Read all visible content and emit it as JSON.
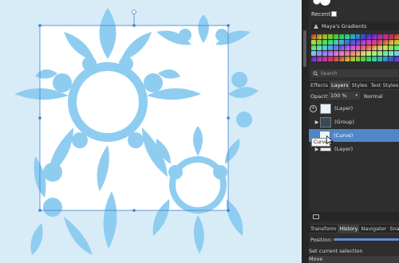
{
  "panel": {
    "recent_label": "Recent:",
    "gradients_name": "Maya's Gradients",
    "search_placeholder": "Search",
    "tabs_top": [
      "Effects",
      "Layers",
      "Styles",
      "Text Styles"
    ],
    "active_top_tab": "Layers",
    "opacity_label": "Opacity:",
    "opacity_value": "100 %",
    "blend_mode": "Normal",
    "layers": [
      {
        "name": "(Layer)",
        "expanded": true
      },
      {
        "name": "(Group)",
        "expanded": false
      },
      {
        "name": "(Curve)",
        "selected": true
      },
      {
        "name": "(Layer)",
        "expanded": false
      }
    ],
    "tooltip": "Curve",
    "tabs_bottom": [
      "Transform",
      "History",
      "Navigator",
      "Snaps"
    ],
    "active_bottom_tab": "History",
    "position_label": "Position:",
    "history_items": [
      "Set current selection",
      "Move"
    ]
  },
  "colors": {
    "canvas_bg": "#d8ecf8",
    "shape": "#8fcdf0",
    "selection": "#3b7fd0",
    "selected_row": "#4f87c9",
    "panel_bg": "#2e2e2e"
  },
  "icons": [
    "gradient-icon",
    "search-icon",
    "eye-icon",
    "layers-stack-icon"
  ]
}
